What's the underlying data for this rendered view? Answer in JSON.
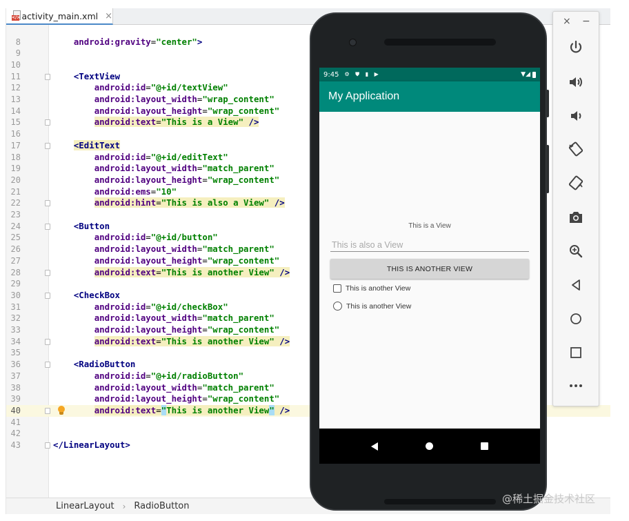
{
  "editor": {
    "tab_label": "activity_main.xml",
    "tab_close": "×",
    "lines": [
      {
        "n": "8",
        "indent": "    ",
        "parts": [
          [
            "attr",
            "android:gravity"
          ],
          [
            "eq",
            "="
          ],
          [
            "val",
            "\"center\""
          ],
          [
            "tag",
            ">"
          ]
        ]
      },
      {
        "n": "9",
        "indent": "",
        "parts": []
      },
      {
        "n": "10",
        "indent": "",
        "parts": []
      },
      {
        "n": "11",
        "indent": "    ",
        "parts": [
          [
            "tag",
            "<TextView"
          ]
        ],
        "fold": true
      },
      {
        "n": "12",
        "indent": "        ",
        "parts": [
          [
            "attr",
            "android:id"
          ],
          [
            "eq",
            "="
          ],
          [
            "val",
            "\"@+id/textView\""
          ]
        ]
      },
      {
        "n": "13",
        "indent": "        ",
        "parts": [
          [
            "attr",
            "android:layout_width"
          ],
          [
            "eq",
            "="
          ],
          [
            "val",
            "\"wrap_content\""
          ]
        ]
      },
      {
        "n": "14",
        "indent": "        ",
        "parts": [
          [
            "attr",
            "android:layout_height"
          ],
          [
            "eq",
            "="
          ],
          [
            "val",
            "\"wrap_content\""
          ]
        ]
      },
      {
        "n": "15",
        "indent": "        ",
        "parts": [
          [
            "attr",
            "android:text"
          ],
          [
            "eq",
            "="
          ],
          [
            "val",
            "\"This is a View\""
          ],
          [
            "tag",
            " />"
          ]
        ],
        "hl": true,
        "fold": true
      },
      {
        "n": "16",
        "indent": "",
        "parts": []
      },
      {
        "n": "17",
        "indent": "    ",
        "parts": [
          [
            "tag",
            "<EditText"
          ]
        ],
        "fold": true,
        "hltag": true
      },
      {
        "n": "18",
        "indent": "        ",
        "parts": [
          [
            "attr",
            "android:id"
          ],
          [
            "eq",
            "="
          ],
          [
            "val",
            "\"@+id/editText\""
          ]
        ]
      },
      {
        "n": "19",
        "indent": "        ",
        "parts": [
          [
            "attr",
            "android:layout_width"
          ],
          [
            "eq",
            "="
          ],
          [
            "val",
            "\"match_parent\""
          ]
        ]
      },
      {
        "n": "20",
        "indent": "        ",
        "parts": [
          [
            "attr",
            "android:layout_height"
          ],
          [
            "eq",
            "="
          ],
          [
            "val",
            "\"wrap_content\""
          ]
        ]
      },
      {
        "n": "21",
        "indent": "        ",
        "parts": [
          [
            "attr",
            "android:ems"
          ],
          [
            "eq",
            "="
          ],
          [
            "val",
            "\"10\""
          ]
        ]
      },
      {
        "n": "22",
        "indent": "        ",
        "parts": [
          [
            "attr",
            "android:hint"
          ],
          [
            "eq",
            "="
          ],
          [
            "val",
            "\"This is also a View\""
          ],
          [
            "tag",
            " />"
          ]
        ],
        "hl": true,
        "fold": true
      },
      {
        "n": "23",
        "indent": "",
        "parts": []
      },
      {
        "n": "24",
        "indent": "    ",
        "parts": [
          [
            "tag",
            "<Button"
          ]
        ],
        "fold": true
      },
      {
        "n": "25",
        "indent": "        ",
        "parts": [
          [
            "attr",
            "android:id"
          ],
          [
            "eq",
            "="
          ],
          [
            "val",
            "\"@+id/button\""
          ]
        ]
      },
      {
        "n": "26",
        "indent": "        ",
        "parts": [
          [
            "attr",
            "android:layout_width"
          ],
          [
            "eq",
            "="
          ],
          [
            "val",
            "\"match_parent\""
          ]
        ]
      },
      {
        "n": "27",
        "indent": "        ",
        "parts": [
          [
            "attr",
            "android:layout_height"
          ],
          [
            "eq",
            "="
          ],
          [
            "val",
            "\"wrap_content\""
          ]
        ]
      },
      {
        "n": "28",
        "indent": "        ",
        "parts": [
          [
            "attr",
            "android:text"
          ],
          [
            "eq",
            "="
          ],
          [
            "val",
            "\"This is another View\""
          ],
          [
            "tag",
            " />"
          ]
        ],
        "hl": true,
        "fold": true
      },
      {
        "n": "29",
        "indent": "",
        "parts": []
      },
      {
        "n": "30",
        "indent": "    ",
        "parts": [
          [
            "tag",
            "<CheckBox"
          ]
        ],
        "fold": true
      },
      {
        "n": "31",
        "indent": "        ",
        "parts": [
          [
            "attr",
            "android:id"
          ],
          [
            "eq",
            "="
          ],
          [
            "val",
            "\"@+id/checkBox\""
          ]
        ]
      },
      {
        "n": "32",
        "indent": "        ",
        "parts": [
          [
            "attr",
            "android:layout_width"
          ],
          [
            "eq",
            "="
          ],
          [
            "val",
            "\"match_parent\""
          ]
        ]
      },
      {
        "n": "33",
        "indent": "        ",
        "parts": [
          [
            "attr",
            "android:layout_height"
          ],
          [
            "eq",
            "="
          ],
          [
            "val",
            "\"wrap_content\""
          ]
        ]
      },
      {
        "n": "34",
        "indent": "        ",
        "parts": [
          [
            "attr",
            "android:text"
          ],
          [
            "eq",
            "="
          ],
          [
            "val",
            "\"This is another View\""
          ],
          [
            "tag",
            " />"
          ]
        ],
        "hl": true,
        "fold": true
      },
      {
        "n": "35",
        "indent": "",
        "parts": []
      },
      {
        "n": "36",
        "indent": "    ",
        "parts": [
          [
            "tag",
            "<RadioButton"
          ]
        ],
        "fold": true
      },
      {
        "n": "37",
        "indent": "        ",
        "parts": [
          [
            "attr",
            "android:id"
          ],
          [
            "eq",
            "="
          ],
          [
            "val",
            "\"@+id/radioButton\""
          ]
        ]
      },
      {
        "n": "38",
        "indent": "        ",
        "parts": [
          [
            "attr",
            "android:layout_width"
          ],
          [
            "eq",
            "="
          ],
          [
            "val",
            "\"match_parent\""
          ]
        ]
      },
      {
        "n": "39",
        "indent": "        ",
        "parts": [
          [
            "attr",
            "android:layout_height"
          ],
          [
            "eq",
            "="
          ],
          [
            "val",
            "\"wrap_content\""
          ]
        ]
      },
      {
        "n": "40",
        "indent": "        ",
        "parts": [
          [
            "attr",
            "android:text"
          ],
          [
            "eq",
            "="
          ],
          [
            "sel",
            "\""
          ],
          [
            "val",
            "This is another View"
          ],
          [
            "sel",
            "\""
          ],
          [
            "tag",
            " />"
          ]
        ],
        "hl": true,
        "fold": true,
        "current": true,
        "bulb": true
      },
      {
        "n": "41",
        "indent": "",
        "parts": []
      },
      {
        "n": "42",
        "indent": "",
        "parts": []
      },
      {
        "n": "43",
        "indent": "",
        "parts": [
          [
            "tag",
            "</LinearLayout>"
          ]
        ],
        "fold": true
      }
    ],
    "breadcrumb": [
      "LinearLayout",
      "RadioButton"
    ],
    "breadcrumb_sep": "›"
  },
  "phone": {
    "status_time": "9:45",
    "status_icons": "⚙ ⛊ ▮ ▶",
    "status_right": "▼◢",
    "app_title": "My Application",
    "textview_text": "This is a View",
    "edittext_hint": "This is also a View",
    "button_label": "THIS IS ANOTHER VIEW",
    "checkbox_label": "This is another View",
    "radio_label": "This is another View"
  },
  "toolbar": {
    "close": "×",
    "minimize": "−",
    "tools": [
      "power-icon",
      "volume-up-icon",
      "volume-down-icon",
      "rotate-left-icon",
      "rotate-right-icon",
      "camera-icon",
      "zoom-icon",
      "back-icon",
      "home-icon",
      "overview-icon",
      "more-icon"
    ]
  },
  "watermark": "@稀土掘金技术社区",
  "colors": {
    "status_bar": "#00695c",
    "app_bar": "#00897b",
    "xml_tag": "#000080",
    "xml_attr": "#500080",
    "xml_value": "#008000"
  }
}
